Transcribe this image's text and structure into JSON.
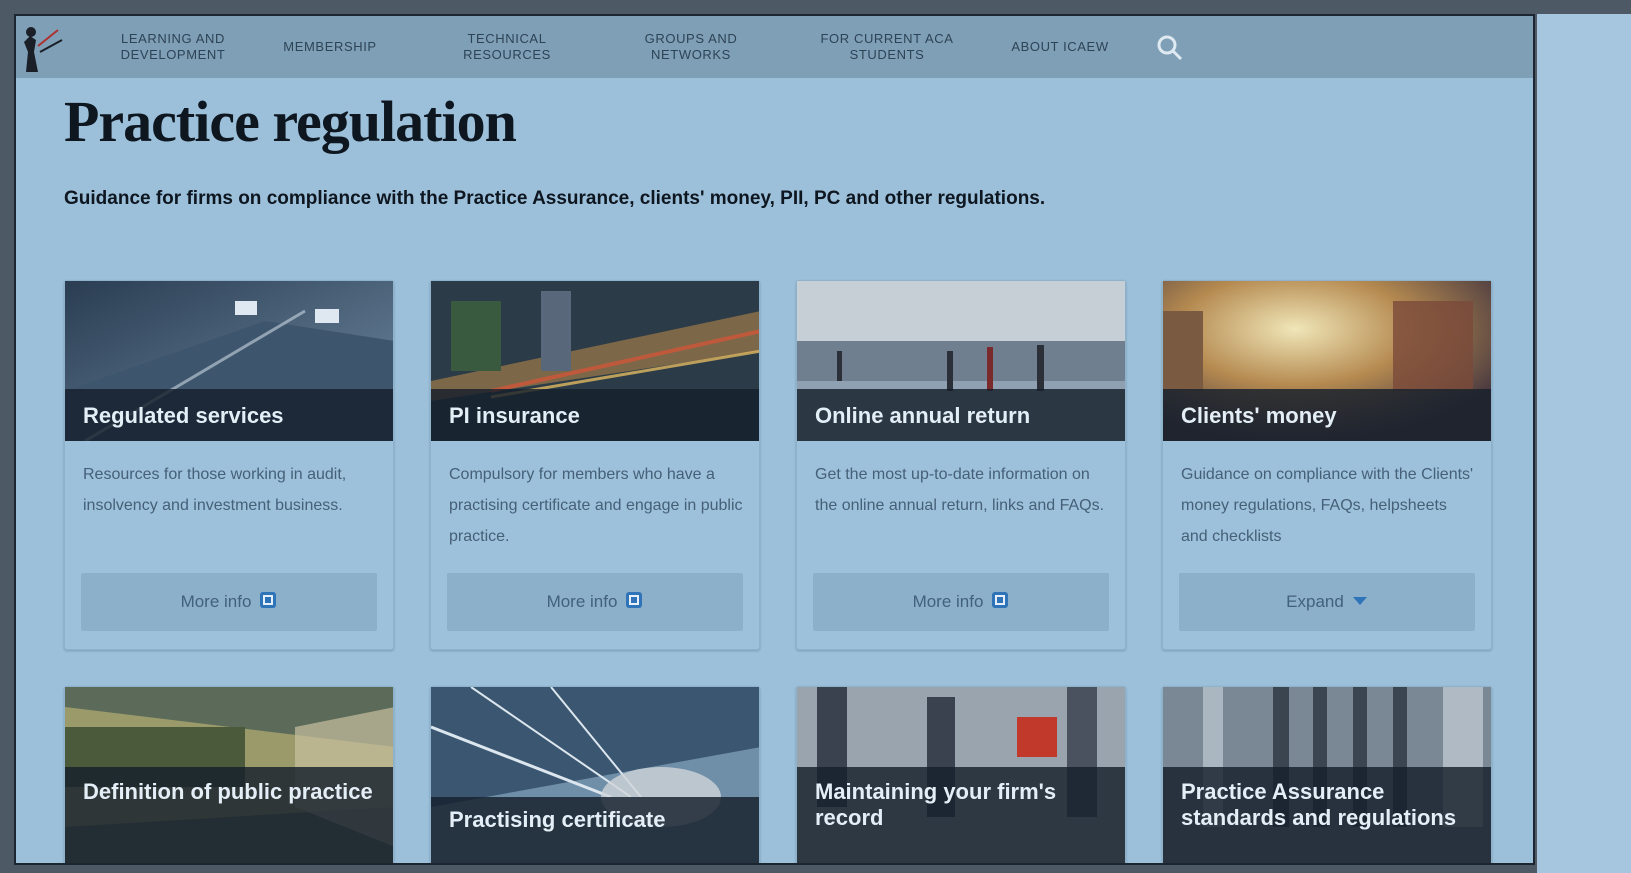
{
  "nav": {
    "items": [
      "LEARNING AND\nDEVELOPMENT",
      "MEMBERSHIP",
      "TECHNICAL\nRESOURCES",
      "GROUPS AND\nNETWORKS",
      "FOR CURRENT ACA\nSTUDENTS",
      "ABOUT ICAEW"
    ]
  },
  "page": {
    "title": "Practice regulation",
    "subtitle": "Guidance for firms on compliance with the Practice Assurance, clients' money, PII, PC and other regulations."
  },
  "cards": [
    {
      "title": "Regulated services",
      "desc": "Resources for those working in audit, insolvency and investment business.",
      "button": "More info",
      "button_icon": "external-link-icon"
    },
    {
      "title": "PI insurance",
      "desc": "Compulsory for members who have a practising certificate and engage in public practice.",
      "button": "More info",
      "button_icon": "external-link-icon"
    },
    {
      "title": "Online annual return",
      "desc": "Get the most up-to-date information on the online annual return, links and FAQs.",
      "button": "More info",
      "button_icon": "external-link-icon"
    },
    {
      "title": "Clients' money",
      "desc": "Guidance on compliance with the Clients' money regulations, FAQs, helpsheets and checklists",
      "button": "Expand",
      "button_icon": "caret-down-icon"
    },
    {
      "title": "Definition of public practice"
    },
    {
      "title": "Practising certificate"
    },
    {
      "title": "Maintaining your firm's record"
    },
    {
      "title": "Practice Assurance standards and regulations"
    }
  ],
  "colors": {
    "nav_bg": "#7f9fb6",
    "page_bg": "#9cc0da",
    "title_text": "#0e1620",
    "label_overlay": "#16202c"
  }
}
